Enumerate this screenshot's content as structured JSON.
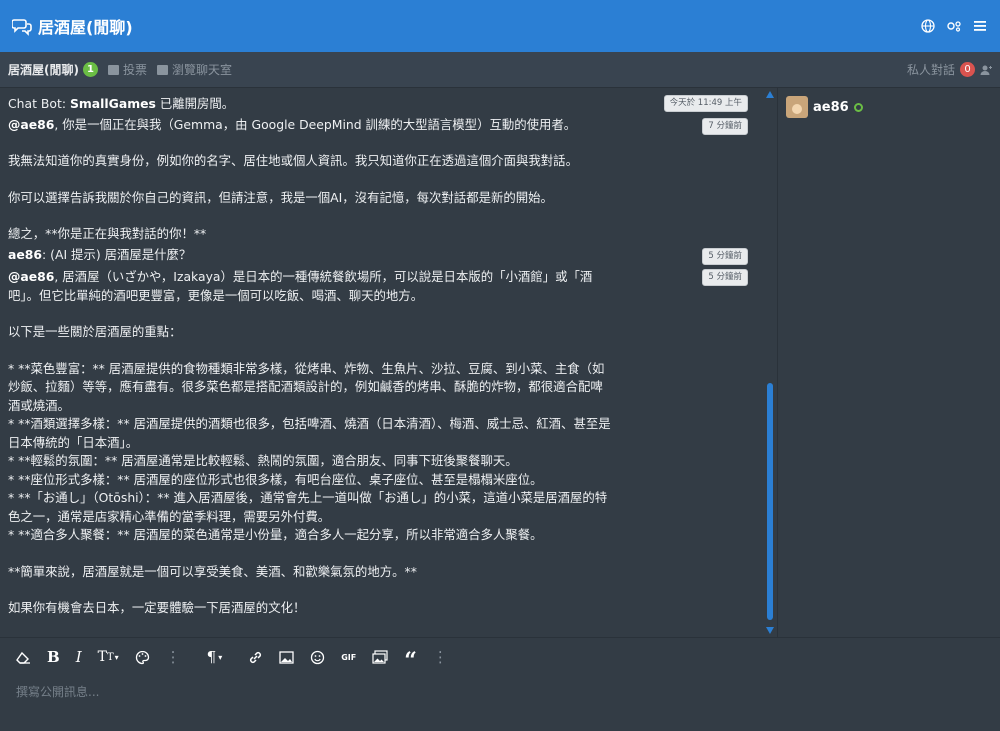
{
  "header": {
    "title": "居酒屋(閒聊)"
  },
  "subbar": {
    "room_name": "居酒屋(閒聊)",
    "room_count": "1",
    "vote_label": "投票",
    "browse_label": "瀏覽聊天室",
    "private_label": "私人對話",
    "private_count": "0"
  },
  "messages": {
    "m1": {
      "user": "Chat Bot:",
      "bold": "SmallGames",
      "text": " 已離開房間。",
      "time": "今天於 11:49 上午"
    },
    "m2": {
      "user": "@ae86",
      "text": ", 你是一個正在與我（Gemma，由 Google DeepMind 訓練的大型語言模型）互動的使用者。",
      "time": "7 分鐘前"
    },
    "p1": "我無法知道你的真實身份，例如你的名字、居住地或個人資訊。我只知道你正在透過這個介面與我對話。",
    "p2": "你可以選擇告訴我關於你自己的資訊，但請注意，我是一個AI，沒有記憶，每次對話都是新的開始。",
    "p3": "總之，**你是正在與我對話的你！**",
    "m3": {
      "user": "ae86",
      "text": ": (AI 提示) 居酒屋是什麼？",
      "time": "5 分鐘前"
    },
    "m4": {
      "user": "@ae86",
      "text": ", 居酒屋（いざかや，Izakaya）是日本的一種傳統餐飲場所，可以說是日本版的「小酒館」或「酒吧」。但它比單純的酒吧更豐富，更像是一個可以吃飯、喝酒、聊天的地方。",
      "time": "5 分鐘前"
    },
    "p4": "以下是一些關於居酒屋的重點：",
    "b1": "* **菜色豐富：** 居酒屋提供的食物種類非常多樣，從烤串、炸物、生魚片、沙拉、豆腐、到小菜、主食（如炒飯、拉麵）等等，應有盡有。很多菜色都是搭配酒類設計的，例如鹹香的烤串、酥脆的炸物，都很適合配啤酒或燒酒。",
    "b2": "* **酒類選擇多樣：** 居酒屋提供的酒類也很多，包括啤酒、燒酒（日本清酒）、梅酒、威士忌、紅酒、甚至是日本傳統的「日本酒」。",
    "b3": "* **輕鬆的氛圍：** 居酒屋通常是比較輕鬆、熱鬧的氛圍，適合朋友、同事下班後聚餐聊天。",
    "b4": "* **座位形式多樣：** 居酒屋的座位形式也很多樣，有吧台座位、桌子座位、甚至是榻榻米座位。",
    "b5": "* **「お通し」（Otōshi）：** 進入居酒屋後，通常會先上一道叫做「お通し」的小菜，這道小菜是居酒屋的特色之一，通常是店家精心準備的當季料理，需要另外付費。",
    "b6": "* **適合多人聚餐：** 居酒屋的菜色通常是小份量，適合多人一起分享，所以非常適合多人聚餐。",
    "p5": "**簡單來說，居酒屋就是一個可以享受美食、美酒、和歡樂氣氛的地方。**",
    "p6": "如果你有機會去日本，一定要體驗一下居酒屋的文化！"
  },
  "users": [
    {
      "name": "ae86"
    }
  ],
  "composer": {
    "placeholder": "撰寫公開訊息..."
  },
  "icons": {
    "top_right": [
      "globe-icon",
      "settings-icon",
      "menu-icon"
    ],
    "toolbar": [
      "eraser-icon",
      "bold-icon",
      "italic-icon",
      "text-size-icon",
      "palette-icon",
      "more-icon",
      "paragraph-icon",
      "link-icon",
      "image-icon",
      "emoji-icon",
      "gif-icon",
      "media-icon",
      "quote-icon",
      "more-icon"
    ]
  },
  "colors": {
    "header_bg": "#2b7fd4",
    "body_bg": "#333c45",
    "online": "#6bbe45",
    "badge_red": "#d9534f"
  }
}
